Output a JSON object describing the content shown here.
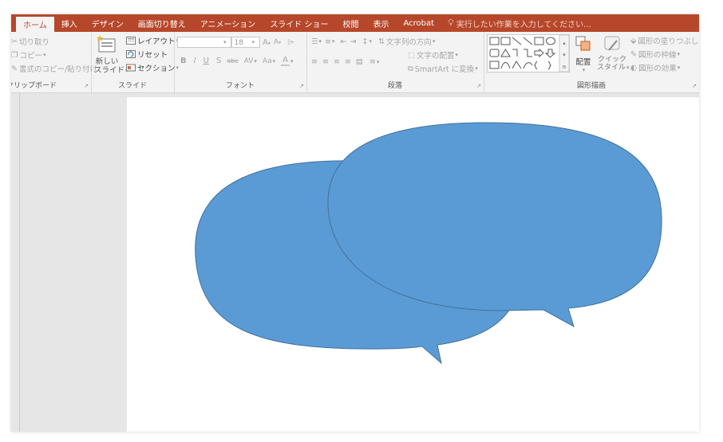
{
  "tabs": [
    {
      "label": "ホーム",
      "active": true
    },
    {
      "label": "挿入"
    },
    {
      "label": "デザイン"
    },
    {
      "label": "画面切り替え"
    },
    {
      "label": "アニメーション"
    },
    {
      "label": "スライド ショー"
    },
    {
      "label": "校閲"
    },
    {
      "label": "表示"
    },
    {
      "label": "Acrobat"
    }
  ],
  "tell_me": "実行したい作業を入力してください...",
  "clipboard": {
    "cut": "切り取り",
    "copy": "コピー",
    "format_painter": "書式のコピー/貼り付け",
    "label": "クリップボード"
  },
  "slides": {
    "new_slide_1": "新しい",
    "new_slide_2": "スライド",
    "layout": "レイアウト",
    "reset": "リセット",
    "section": "セクション",
    "label": "スライド"
  },
  "font": {
    "size": "18",
    "label": "フォント"
  },
  "paragraph": {
    "text_direction": "文字列の方向",
    "align_text": "文字の配置",
    "smartart": "SmartArt に変換",
    "label": "段落"
  },
  "drawing": {
    "arrange": "配置",
    "quick_styles_1": "クイック",
    "quick_styles_2": "スタイル",
    "fill": "図形の塗りつぶし",
    "outline": "図形の枠線",
    "effects": "図形の効果",
    "label": "図形描画"
  },
  "colors": {
    "accent": "#b7472a",
    "shape_fill": "#5b9bd5",
    "shape_outline": "#41719c"
  }
}
